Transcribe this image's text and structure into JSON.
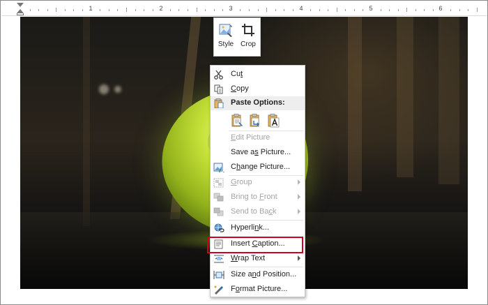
{
  "ruler": {
    "numbers": [
      "1",
      "2",
      "3",
      "4",
      "5",
      "6"
    ]
  },
  "mini_toolbar": {
    "style_label": "Style",
    "crop_label": "Crop"
  },
  "context_menu": {
    "items": [
      {
        "label": "Cut",
        "accel_index": 2,
        "icon": "scissors-icon",
        "enabled": true
      },
      {
        "label": "Copy",
        "accel_index": 0,
        "icon": "copy-icon",
        "enabled": true
      },
      {
        "label": "Paste Options:",
        "icon": "clipboard-icon",
        "header": true
      },
      {
        "label": "Edit Picture",
        "accel_index": 0,
        "enabled": false
      },
      {
        "label": "Save as Picture...",
        "accel_index": 6,
        "enabled": true
      },
      {
        "label": "Change Picture...",
        "accel_index": 1,
        "icon": "change-picture-icon",
        "enabled": true
      },
      {
        "label": "Group",
        "accel_index": 0,
        "icon": "group-icon",
        "enabled": false,
        "submenu": true
      },
      {
        "label": "Bring to Front",
        "accel_index": 9,
        "icon": "bring-front-icon",
        "enabled": false,
        "submenu": true
      },
      {
        "label": "Send to Back",
        "accel_index": 10,
        "icon": "send-back-icon",
        "enabled": false,
        "submenu": true
      },
      {
        "label": "Hyperlink...",
        "accel_index": 7,
        "icon": "hyperlink-icon",
        "enabled": true
      },
      {
        "label": "Insert Caption...",
        "accel_index": 7,
        "icon": "caption-icon",
        "enabled": true,
        "highlighted": true
      },
      {
        "label": "Wrap Text",
        "accel_index": 0,
        "icon": "wrap-text-icon",
        "enabled": true,
        "submenu": true
      },
      {
        "label": "Size and Position...",
        "accel_index": 6,
        "icon": "size-position-icon",
        "enabled": true
      },
      {
        "label": "Format Picture...",
        "accel_index": 1,
        "icon": "format-picture-icon",
        "enabled": true
      }
    ],
    "paste_options": [
      "paste-keep-formatting-icon",
      "paste-merge-formatting-icon",
      "paste-text-only-icon"
    ]
  },
  "colors": {
    "highlight_box": "#d0021b",
    "disabled_text": "#a4a4a4",
    "accent_blue": "#2b6cb0"
  }
}
